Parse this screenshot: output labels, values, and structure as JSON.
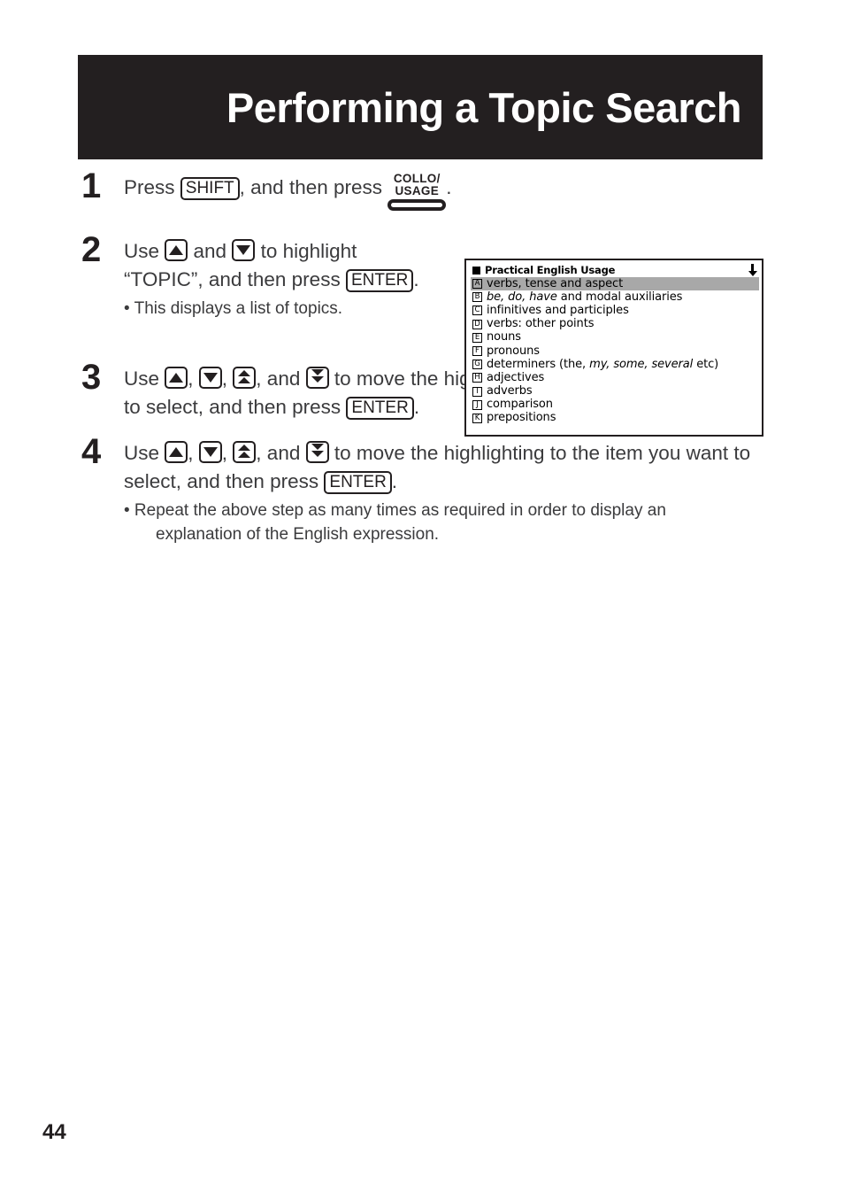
{
  "page": {
    "title": "Performing a Topic Search",
    "number": "44"
  },
  "steps": [
    {
      "num": "1",
      "text_before": "Press ",
      "key1": "SHIFT",
      "text_mid": ", and then press ",
      "collo_line1": "COLLO/",
      "collo_line2": "USAGE",
      "text_after": "."
    },
    {
      "num": "2",
      "l1_a": "Use ",
      "l1_b": " and ",
      "l1_c": " to highlight",
      "l2_a": "“TOPIC”, and then press ",
      "enter": "ENTER",
      "l2_b": ".",
      "note": "• This displays a list of topics."
    },
    {
      "num": "3",
      "a": "Use ",
      "b": ", ",
      "c": ", ",
      "d": ", and ",
      "e": " to move the highlighting to the topic list you want to select, and then press ",
      "enter": "ENTER",
      "f": "."
    },
    {
      "num": "4",
      "a": "Use ",
      "b": ", ",
      "c": ", ",
      "d": ", and ",
      "e": " to move the highlighting to the item you want to select, and then press ",
      "enter": "ENTER",
      "f": ".",
      "note_bullet": "• Repeat the above step as many times as required in order to display an",
      "note_cont": "explanation of the English expression."
    }
  ],
  "lcd": {
    "header_title": "Practical English Usage",
    "scroll_indicator": "down-arrow",
    "rows": [
      {
        "letter": "A",
        "text": "verbs, tense and aspect",
        "selected": true
      },
      {
        "letter": "B",
        "text": "be, do, have and modal auxiliaries",
        "selected": false,
        "italic_parts": [
          "be,",
          "do,",
          "have"
        ]
      },
      {
        "letter": "C",
        "text": "infinitives and participles",
        "selected": false
      },
      {
        "letter": "D",
        "text": "verbs: other points",
        "selected": false
      },
      {
        "letter": "E",
        "text": "nouns",
        "selected": false
      },
      {
        "letter": "F",
        "text": "pronouns",
        "selected": false
      },
      {
        "letter": "G",
        "text": "determiners (the, my, some, several etc)",
        "selected": false,
        "italic_parts": [
          "the,",
          "my,",
          "some,",
          "several"
        ]
      },
      {
        "letter": "H",
        "text": "adjectives",
        "selected": false
      },
      {
        "letter": "I",
        "text": "adverbs",
        "selected": false
      },
      {
        "letter": "J",
        "text": "comparison",
        "selected": false
      },
      {
        "letter": "K",
        "text": "prepositions",
        "selected": false
      }
    ]
  },
  "colors": {
    "banner_bg": "#231f20",
    "banner_text": "#ffffff",
    "body_text": "#3b3b3d",
    "lcd_highlight": "#a8a8a8",
    "lcd_bg": "#ffffff"
  }
}
